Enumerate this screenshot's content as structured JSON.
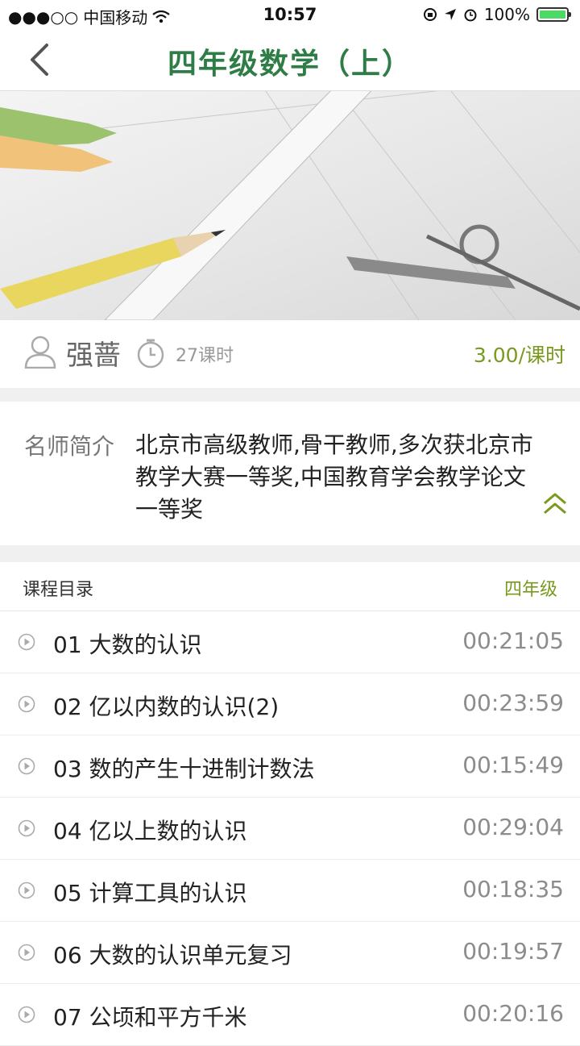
{
  "status_bar": {
    "carrier": "中国移动",
    "time": "10:57",
    "battery": "100%"
  },
  "nav": {
    "title": "四年级数学（上）"
  },
  "course": {
    "teacher": "强蔷",
    "hours": "27课时",
    "price": "3.00/课时"
  },
  "intro": {
    "label": "名师简介",
    "text": "北京市高级教师,骨干教师,多次获北京市教学大赛一等奖,中国教育学会教学论文一等奖"
  },
  "catalog": {
    "title": "课程目录",
    "grade": "四年级",
    "lessons": [
      {
        "name": "01 大数的认识",
        "duration": "00:21:05"
      },
      {
        "name": "02 亿以内数的认识(2)",
        "duration": "00:23:59"
      },
      {
        "name": "03 数的产生十进制计数法",
        "duration": "00:15:49"
      },
      {
        "name": "04 亿以上数的认识",
        "duration": "00:29:04"
      },
      {
        "name": "05 计算工具的认识",
        "duration": "00:18:35"
      },
      {
        "name": "06 大数的认识单元复习",
        "duration": "00:19:57"
      },
      {
        "name": "07 公顷和平方千米",
        "duration": "00:20:16"
      }
    ]
  },
  "colors": {
    "title_green": "#2f7d46",
    "accent_olive": "#7a9a1f"
  }
}
